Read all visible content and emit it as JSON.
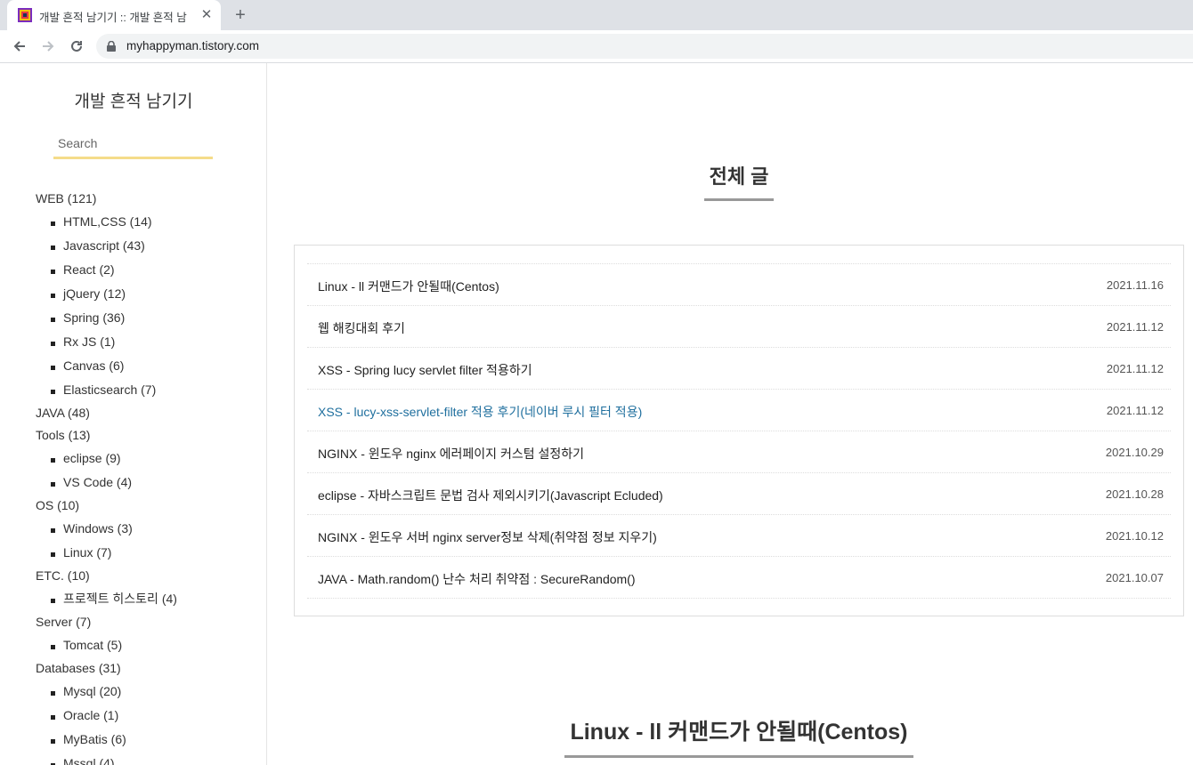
{
  "browser": {
    "tab_title": "개발 흔적 남기기 :: 개발 흔적 남",
    "tab_close": "✕",
    "new_tab": "+",
    "url": "myhappyman.tistory.com"
  },
  "sidebar": {
    "blog_title": "개발 흔적 남기기",
    "search_placeholder": "Search",
    "categories": [
      {
        "label": "WEB (121)",
        "subs": [
          "HTML,CSS (14)",
          "Javascript (43)",
          "React (2)",
          "jQuery (12)",
          "Spring (36)",
          "Rx JS (1)",
          "Canvas (6)",
          "Elasticsearch (7)"
        ]
      },
      {
        "label": "JAVA (48)",
        "subs": []
      },
      {
        "label": "Tools (13)",
        "subs": [
          "eclipse (9)",
          "VS Code (4)"
        ]
      },
      {
        "label": "OS (10)",
        "subs": [
          "Windows (3)",
          "Linux (7)"
        ]
      },
      {
        "label": "ETC. (10)",
        "subs": [
          "프로젝트 히스토리 (4)"
        ]
      },
      {
        "label": "Server (7)",
        "subs": [
          "Tomcat (5)"
        ]
      },
      {
        "label": "Databases (31)",
        "subs": [
          "Mysql (20)",
          "Oracle (1)",
          "MyBatis (6)",
          "Mssql (4)"
        ]
      }
    ]
  },
  "main": {
    "section_title": "전체 글",
    "posts": [
      {
        "title": "Linux - ll 커맨드가 안될때(Centos)",
        "date": "2021.11.16"
      },
      {
        "title": "웹 해킹대회 후기",
        "date": "2021.11.12"
      },
      {
        "title": "XSS - Spring lucy servlet filter 적용하기",
        "date": "2021.11.12"
      },
      {
        "title": "XSS - lucy-xss-servlet-filter 적용 후기(네이버 루시 필터 적용)",
        "date": "2021.11.12"
      },
      {
        "title": "NGINX - 윈도우 nginx 에러페이지 커스텀 설정하기",
        "date": "2021.10.29"
      },
      {
        "title": "eclipse - 자바스크립트 문법 검사 제외시키기(Javascript Ecluded)",
        "date": "2021.10.28"
      },
      {
        "title": "NGINX - 윈도우 서버 nginx server정보 삭제(취약점 정보 지우기)",
        "date": "2021.10.12"
      },
      {
        "title": "JAVA - Math.random() 난수 처리 취약점 : SecureRandom()",
        "date": "2021.10.07"
      }
    ],
    "article_title": "Linux - ll 커맨드가 안될때(Centos)"
  },
  "colors": {
    "search_underline": "#f5dc8a",
    "link_color": "#1f6f9e"
  }
}
